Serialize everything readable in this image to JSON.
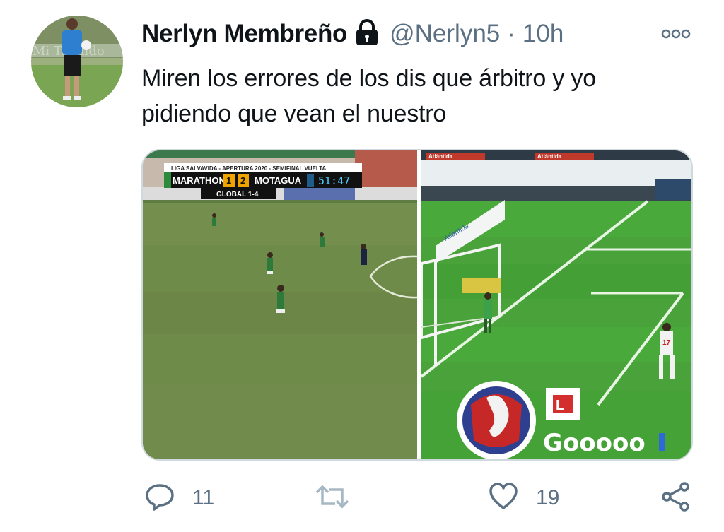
{
  "tweet": {
    "display_name": "Nerlyn Membreño",
    "handle": "@Nerlyn5",
    "separator": "·",
    "time": "10h",
    "text_line1": "Miren los errores de los dis que árbitro y yo",
    "text_line2": "pidiendo que vean el nuestro",
    "avatar_icon": "avatar-photo",
    "protected_icon": "lock-icon",
    "more_icon": "more-options-icon"
  },
  "media": {
    "left": {
      "league": "LIGA SALVAVIDA - APERTURA 2020 - SEMIFINAL VUELTA",
      "team_home": "MARATHON",
      "score_home": "1",
      "score_away": "2",
      "team_away": "MOTAGUA",
      "clock": "51:47",
      "aggregate": "GLOBAL 1-4"
    },
    "right": {
      "banner1": "Atlántida",
      "banner2": "Atlántida",
      "goal_text": "Gooooo",
      "jersey_number": "17"
    }
  },
  "actions": {
    "reply_count": "11",
    "retweet_count": "",
    "like_count": "19",
    "icons": [
      "reply-icon",
      "retweet-icon",
      "like-icon",
      "share-icon"
    ]
  },
  "colors": {
    "text": "#0f1419",
    "secondary": "#5b7083",
    "pitch_left": "#6f8b4a",
    "pitch_right": "#49a33a"
  }
}
